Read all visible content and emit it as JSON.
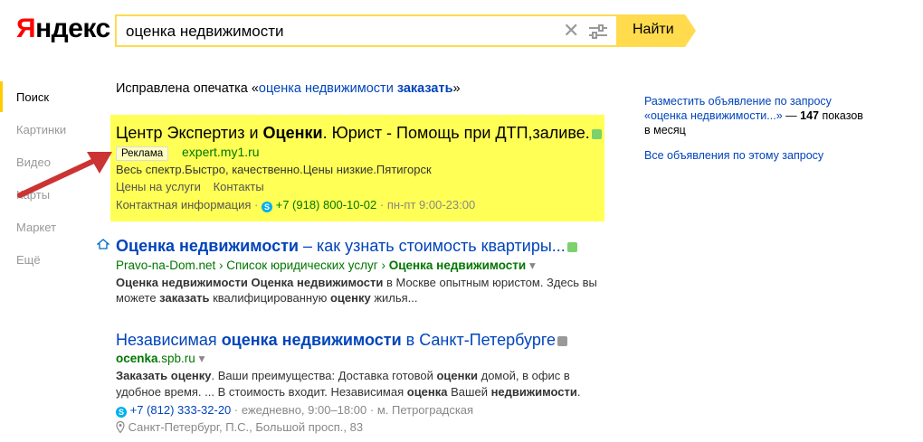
{
  "logo": {
    "first": "Я",
    "rest": "ндекс"
  },
  "search": {
    "value": "оценка недвижимости",
    "button": "Найти"
  },
  "nav": {
    "items": [
      "Поиск",
      "Картинки",
      "Видео",
      "Карты",
      "Маркет",
      "Ещё"
    ]
  },
  "correction": {
    "prefix": "Исправлена опечатка «",
    "query": "оценка недвижимости",
    "bold": "заказать",
    "suffix": "»"
  },
  "ad": {
    "title_a": "Центр Экспертиз и ",
    "title_b": "Оценки",
    "title_c": ". Юрист - Помощь при ДТП,заливе.",
    "badge": "Реклама",
    "url": "expert.my1.ru",
    "desc": "Весь спектр.Быстро, качественно.Цены низкие.Пятигорск",
    "link1": "Цены на услуги",
    "link2": "Контакты",
    "contact": "Контактная информация",
    "dot": "·",
    "phone": "+7 (918) 800-10-02",
    "hours": "пн-пт 9:00-23:00"
  },
  "result1": {
    "title_a": "Оценка недвижимости",
    "title_b": " – как узнать стоимость квартиры...",
    "domain": "Pravo-na-Dom.net",
    "sep": " › ",
    "crumb1": "Список юридических услуг",
    "crumb2": "Оценка недвижимости",
    "line1_a": "Оценка недвижимости Оценка недвижимости",
    "line1_b": " в Москве опытным юристом. Здесь вы",
    "line2_a": "можете ",
    "line2_b": "заказать",
    "line2_c": " квалифицированную ",
    "line2_d": "оценку",
    "line2_e": " жилья..."
  },
  "result2": {
    "title_a": "Независимая ",
    "title_b": "оценка недвижимости",
    "title_c": " в Санкт-Петербурге",
    "domain_a": "ocenka",
    "domain_b": ".spb.ru",
    "line1_a": "Заказать оценку",
    "line1_b": ". Ваши преимущества: Доставка готовой ",
    "line1_c": "оценки",
    "line1_d": " домой, в офис в",
    "line2_a": "удобное время. ... В стоимость входит. Независимая ",
    "line2_b": "оценка",
    "line2_c": " Вашей ",
    "line2_d": "недвижимости",
    "line2_e": ".",
    "phone": "+7 (812) 333-32-20",
    "dot": "·",
    "hours": "ежедневно, 9:00–18:00",
    "metro": "м. Петроградская",
    "address": "Санкт-Петербург, П.С., Большой просп., 83"
  },
  "right": {
    "l1": "Разместить объявление по запросу",
    "l2": "«оценка недвижимости...»",
    "l2b": " — ",
    "count": "147",
    "l2c": " показов",
    "l3": "в месяц",
    "all": "Все объявления по этому запросу"
  },
  "colors": {
    "accent": "#ffdb4d",
    "link": "#0044bb",
    "url_green": "#007700",
    "ad_bg": "#ffff55"
  }
}
